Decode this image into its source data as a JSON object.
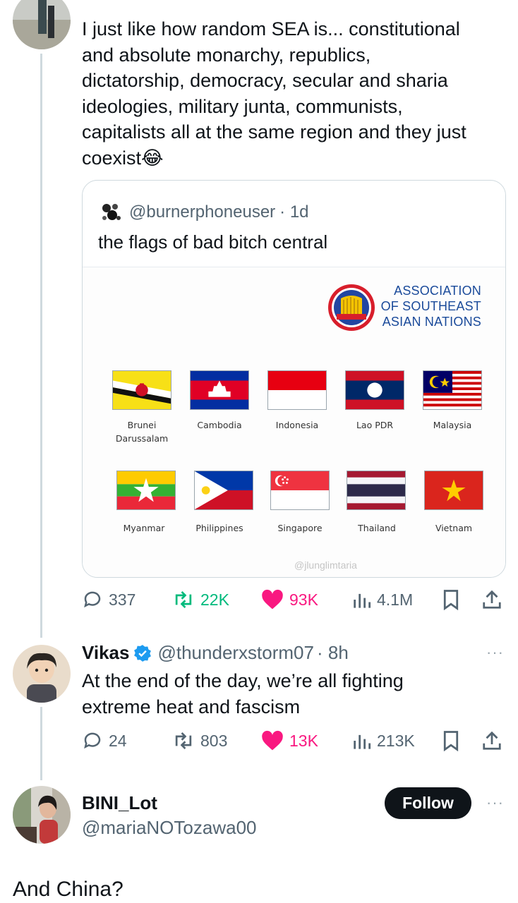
{
  "thread": {
    "main_tweet": {
      "text": "I just like how random SEA is... constitutional and absolute monarchy, republics, dictatorship, democracy, secular and sharia ideologies, military junta, communists, capitalists all at the same region and they just coexist😂",
      "lines": [
        "I just like how random SEA is... constitutional",
        "and absolute monarchy, republics,",
        "dictatorship, democracy, secular and sharia",
        "ideologies, military junta, communists,",
        "capitalists all at the same region and they just",
        "coexist😂"
      ],
      "quote": {
        "handle": "@burnerphoneuser",
        "time": "· 1d",
        "text": "the flags of bad bitch central",
        "image": {
          "org_title_lines": [
            "ASSOCIATION",
            "OF SOUTHEAST",
            "ASIAN NATIONS"
          ],
          "flags_row1": [
            "Brunei Darussalam",
            "Cambodia",
            "Indonesia",
            "Lao PDR",
            "Malaysia"
          ],
          "flags_row2": [
            "Myanmar",
            "Philippines",
            "Singapore",
            "Thailand",
            "Vietnam"
          ],
          "brunei_lines": [
            "Brunei",
            "Darussalam"
          ],
          "watermark": "@jlunglimtaria"
        }
      },
      "stats": {
        "replies": "337",
        "retweets": "22K",
        "likes": "93K",
        "views": "4.1M"
      }
    },
    "reply1": {
      "name": "Vikas",
      "handle": "@thunderxstorm07",
      "time": "· 8h",
      "lines": [
        "At the end of the day, we’re all fighting",
        "extreme heat and fascism"
      ],
      "stats": {
        "replies": "24",
        "retweets": "803",
        "likes": "13K",
        "views": "213K"
      },
      "more": "···"
    },
    "reply2": {
      "name": "BINI_Lot",
      "handle": "@mariaNOTozawa00",
      "follow_label": "Follow",
      "more": "···",
      "text": "And China?"
    }
  },
  "colors": {
    "text": "#0f1419",
    "muted": "#536471",
    "retweet": "#00ba7c",
    "like": "#f91880",
    "border": "#cfd9de",
    "asean_blue": "#1a4a9a"
  },
  "icons": [
    "reply-icon",
    "retweet-icon",
    "heart-icon",
    "views-icon",
    "bookmark-icon",
    "share-icon",
    "verified-icon",
    "more-icon"
  ]
}
